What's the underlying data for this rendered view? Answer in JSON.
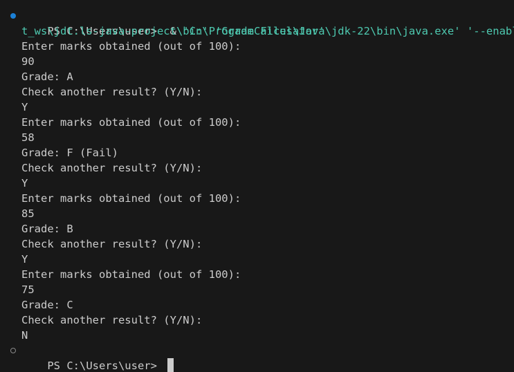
{
  "terminal": {
    "command_prompt": "PS C:\\Users\\user> ",
    "command_operator": " & ",
    "command_arg1": "'C:\\Program Files\\Java\\jdk-22\\bin\\java.exe'",
    "command_arg2": " '--enable-prev",
    "command_wrap": "t_ws\\jdt.ls-java-project\\bin'",
    "command_class": " 'GradeCalculator'",
    "output": [
      "Enter marks obtained (out of 100):",
      "90",
      "Grade: A",
      "Check another result? (Y/N):",
      "Y",
      "Enter marks obtained (out of 100):",
      "58",
      "Grade: F (Fail)",
      "Check another result? (Y/N):",
      "Y",
      "Enter marks obtained (out of 100):",
      "85",
      "Grade: B",
      "Check another result? (Y/N):",
      "Y",
      "Enter marks obtained (out of 100):",
      "75",
      "Grade: C",
      "Check another result? (Y/N):",
      "N"
    ],
    "final_prompt": "PS C:\\Users\\user> "
  },
  "colors": {
    "background": "#181818",
    "text": "#cccccc",
    "string": "#4ec9b0",
    "decoration_success": "#1b80d6"
  }
}
